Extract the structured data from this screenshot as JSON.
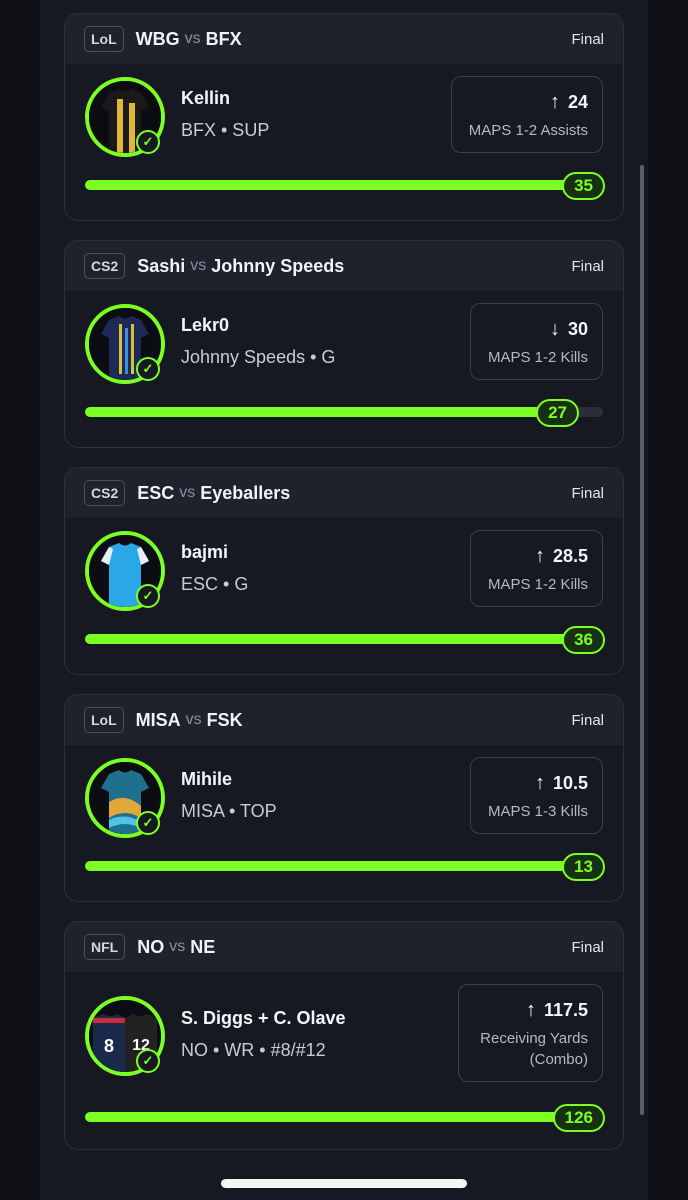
{
  "cards": [
    {
      "league": "LoL",
      "team1": "WBG",
      "vs": "vs",
      "team2": "BFX",
      "status": "Final",
      "player": "Kellin",
      "meta": "BFX • SUP",
      "direction": "up",
      "arrow": "↑",
      "line": "24",
      "stat": "MAPS 1-2 Assists",
      "actual": "35",
      "progress": 1.0,
      "jersey": {
        "primary": "#1a1a1a",
        "accent": "#e1b73a"
      }
    },
    {
      "league": "CS2",
      "team1": "Sashi",
      "vs": "vs",
      "team2": "Johnny Speeds",
      "status": "Final",
      "player": "Lekr0",
      "meta": "Johnny Speeds • G",
      "direction": "down",
      "arrow": "↓",
      "line": "30",
      "stat": "MAPS 1-2 Kills",
      "actual": "27",
      "progress": 0.9,
      "jersey": {
        "primary": "#1d2a55",
        "accent": "#d8c13a"
      }
    },
    {
      "league": "CS2",
      "team1": "ESC",
      "vs": "vs",
      "team2": "Eyeballers",
      "status": "Final",
      "player": "bajmi",
      "meta": "ESC • G",
      "direction": "up",
      "arrow": "↑",
      "line": "28.5",
      "stat": "MAPS 1-2 Kills",
      "actual": "36",
      "progress": 1.0,
      "jersey": {
        "primary": "#2aa7e6",
        "accent": "#e9eef2"
      }
    },
    {
      "league": "LoL",
      "team1": "MISA",
      "vs": "vs",
      "team2": "FSK",
      "status": "Final",
      "player": "Mihile",
      "meta": "MISA • TOP",
      "direction": "up",
      "arrow": "↑",
      "line": "10.5",
      "stat": "MAPS 1-3 Kills",
      "actual": "13",
      "progress": 1.0,
      "jersey": {
        "primary": "#1f6f8e",
        "accent": "#e0a83a"
      }
    },
    {
      "league": "NFL",
      "team1": "NO",
      "vs": "vs",
      "team2": "NE",
      "status": "Final",
      "player": "S. Diggs + C. Olave",
      "meta": "NO • WR • #8/#12",
      "direction": "up",
      "arrow": "↑",
      "line": "117.5",
      "stat": "Receiving Yards (Combo)",
      "actual": "126",
      "progress": 1.0,
      "jersey": {
        "primary": "#1b2a4a",
        "accent": "#c62d3c",
        "number1": "8",
        "number2": "12"
      }
    }
  ],
  "colors": {
    "accent": "#7cff22",
    "card_bg": "#161922",
    "header_bg": "#1e222d",
    "page_bg": "#0e1016"
  }
}
